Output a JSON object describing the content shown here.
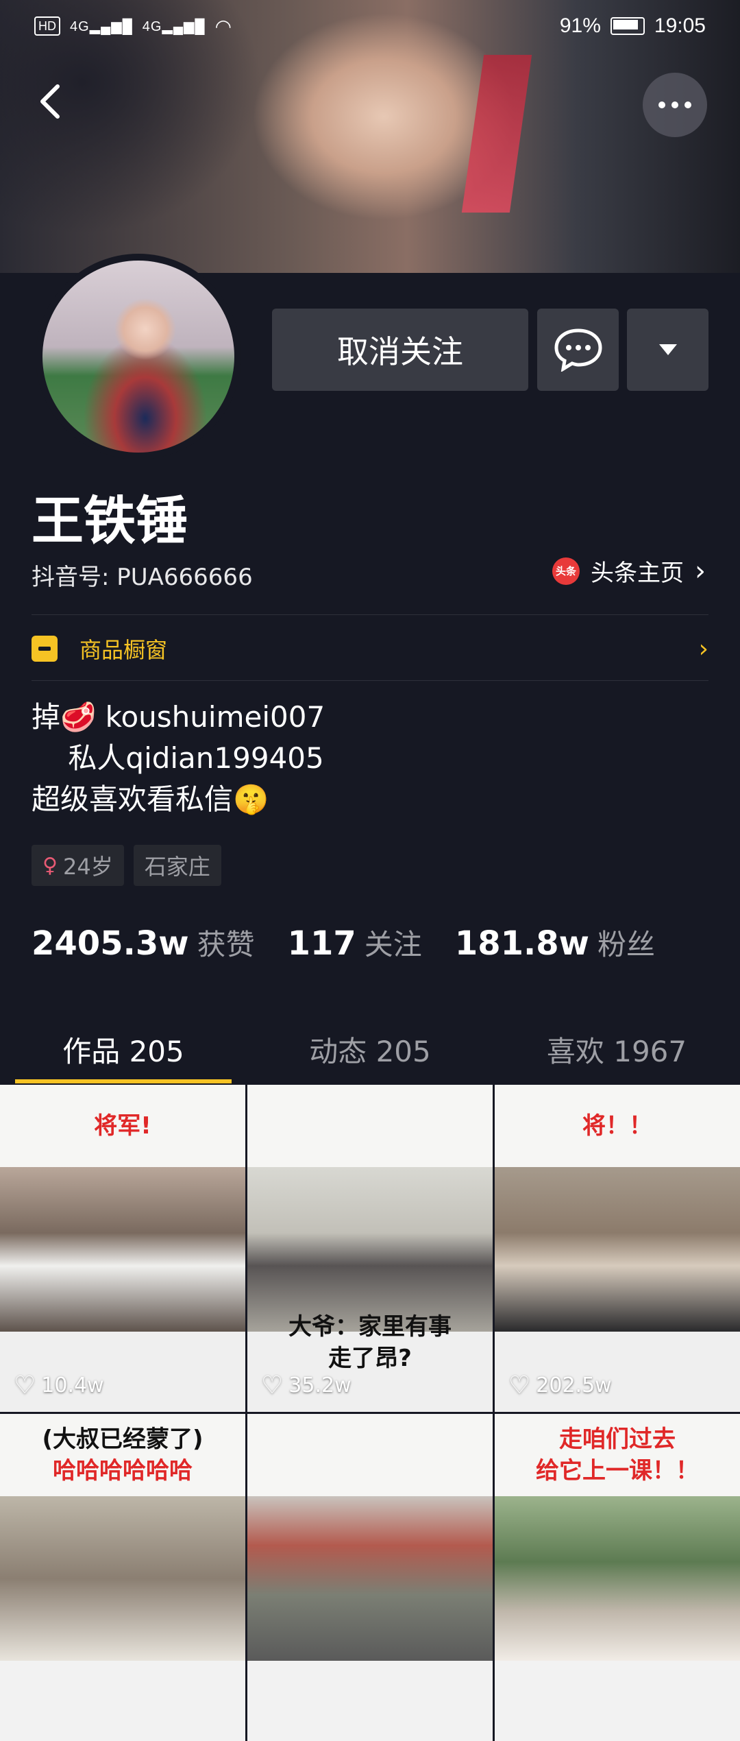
{
  "status_bar": {
    "hd_label": "HD",
    "signal_1": "4G",
    "signal_2": "4G",
    "battery_percent": "91%",
    "time": "19:05"
  },
  "header": {
    "back_icon": "chevron-left-icon",
    "more_icon": "more-horizontal-icon"
  },
  "actions": {
    "unfollow_label": "取消关注",
    "message_icon": "chat-bubble-icon",
    "dropdown_icon": "triangle-down-icon"
  },
  "profile": {
    "name": "王铁锤",
    "douyin_id": "抖音号: PUA666666",
    "toutiao_badge": "头条",
    "toutiao_label": "头条主页",
    "shop_label": "商品橱窗",
    "bio": "掉🥩 koushuimei007\n    私人qidian199405\n超级喜欢看私信🤫",
    "tags": {
      "age": "24岁",
      "city": "石家庄"
    }
  },
  "stats": {
    "likes_count": "2405.3w",
    "likes_label": "获赞",
    "following_count": "117",
    "following_label": "关注",
    "followers_count": "181.8w",
    "followers_label": "粉丝"
  },
  "tabs": [
    {
      "label": "作品 205",
      "active": true
    },
    {
      "label": "动态 205",
      "active": false
    },
    {
      "label": "喜欢 1967",
      "active": false
    }
  ],
  "videos": [
    {
      "top_caption": "将军!",
      "likes": "10.4w"
    },
    {
      "bottom_caption_1": "大爷：家里有事",
      "bottom_caption_2": "走了昂?",
      "likes": "35.2w"
    },
    {
      "top_caption": "将！！",
      "likes": "202.5w"
    },
    {
      "top_caption_black": "(大叔已经蒙了)",
      "top_caption": "哈哈哈哈哈哈"
    },
    {},
    {
      "top_caption": "走咱们过去",
      "top_caption_2": "给它上一课！！"
    }
  ],
  "colors": {
    "background": "#161823",
    "accent": "#f6c324",
    "button": "#393b44"
  }
}
